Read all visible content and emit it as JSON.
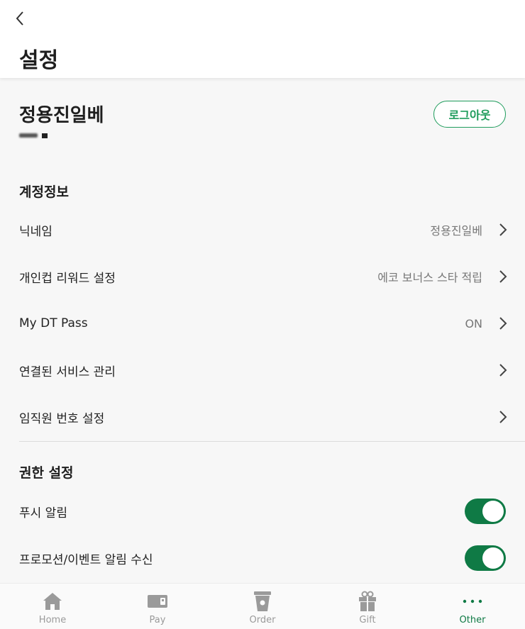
{
  "header": {
    "title": "설정"
  },
  "profile": {
    "name": "정용진일베",
    "logout_label": "로그아웃"
  },
  "account_section": {
    "title": "계정정보",
    "rows": [
      {
        "label": "닉네임",
        "value": "정용진일베"
      },
      {
        "label": "개인컵 리워드 설정",
        "value": "에코 보너스 스타 적립"
      },
      {
        "label": "My DT Pass",
        "value": "ON"
      },
      {
        "label": "연결된 서비스 관리",
        "value": ""
      },
      {
        "label": "임직원 번호 설정",
        "value": ""
      }
    ]
  },
  "permission_section": {
    "title": "권한 설정",
    "toggles": [
      {
        "label": "푸시 알림",
        "on": true
      },
      {
        "label": "프로모션/이벤트 알림 수신",
        "on": true
      }
    ]
  },
  "tabbar": {
    "tabs": [
      {
        "label": "Home",
        "icon": "home-icon"
      },
      {
        "label": "Pay",
        "icon": "card-icon"
      },
      {
        "label": "Order",
        "icon": "cup-icon"
      },
      {
        "label": "Gift",
        "icon": "gift-icon"
      },
      {
        "label": "Other",
        "icon": "more-dots-icon",
        "active": true
      }
    ]
  },
  "colors": {
    "accent": "#0f7a45",
    "logout_border": "#1f9c5c"
  }
}
